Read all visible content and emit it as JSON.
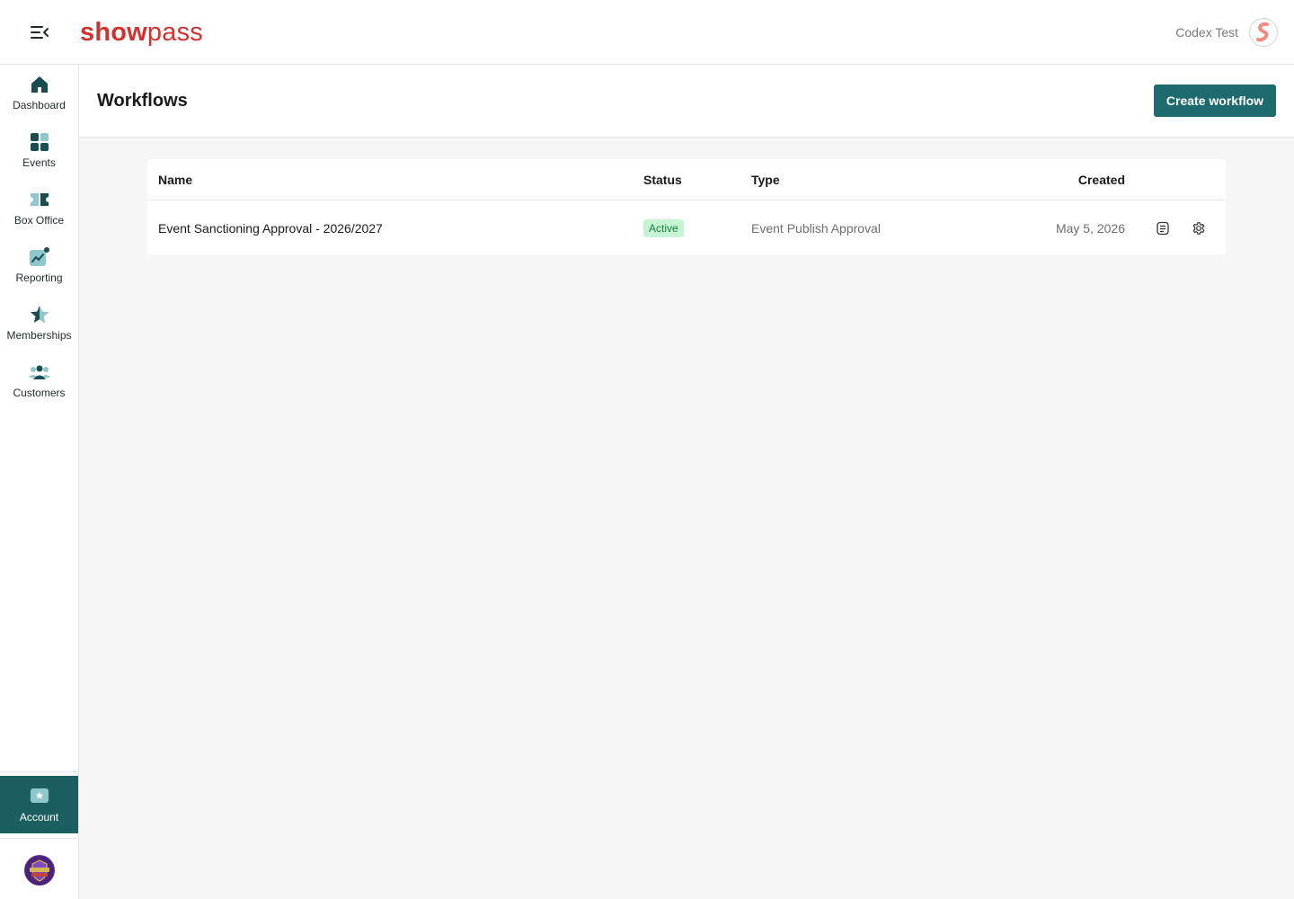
{
  "header": {
    "logo_bold": "show",
    "logo_light": "pass",
    "user_name": "Codex Test"
  },
  "sidebar": {
    "items": [
      {
        "label": "Dashboard",
        "icon": "home-icon"
      },
      {
        "label": "Events",
        "icon": "grid-icon"
      },
      {
        "label": "Box Office",
        "icon": "ticket-icon"
      },
      {
        "label": "Reporting",
        "icon": "chart-icon"
      },
      {
        "label": "Memberships",
        "icon": "star-icon"
      },
      {
        "label": "Customers",
        "icon": "users-icon"
      }
    ],
    "account_label": "Account"
  },
  "page": {
    "title": "Workflows",
    "create_button": "Create workflow"
  },
  "table": {
    "columns": [
      "Name",
      "Status",
      "Type",
      "Created"
    ],
    "rows": [
      {
        "name": "Event Sanctioning Approval - 2026/2027",
        "status": "Active",
        "type": "Event Publish Approval",
        "created": "May 5, 2026"
      }
    ]
  },
  "colors": {
    "brand_red": "#d0322f",
    "primary_teal": "#1d6b6e",
    "account_active": "#1d5e61",
    "status_active_bg": "#c6f5d4"
  }
}
